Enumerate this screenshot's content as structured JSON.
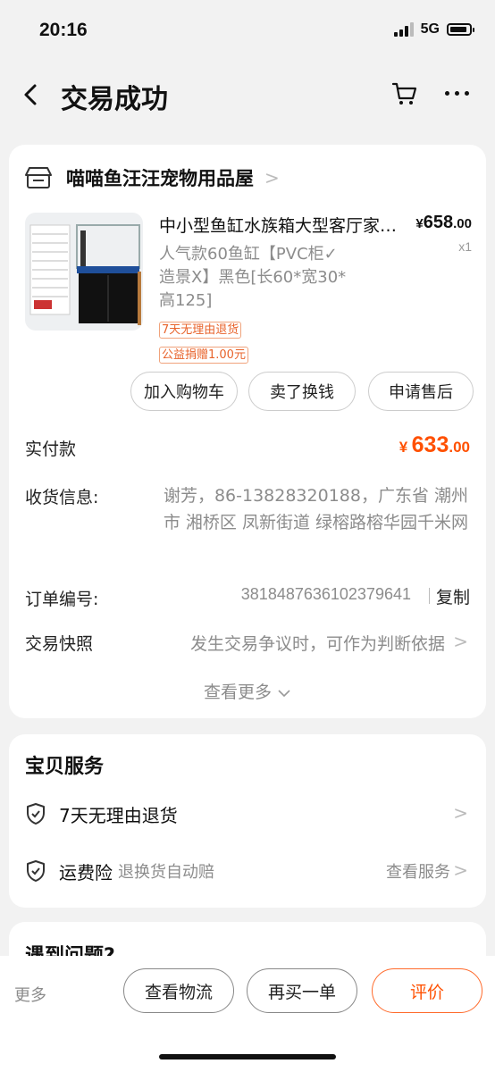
{
  "status": {
    "time": "20:16",
    "network": "5G"
  },
  "nav": {
    "title": "交易成功"
  },
  "shop": {
    "name": "喵喵鱼汪汪宠物用品屋"
  },
  "product": {
    "title": "中小型鱼缸水族箱大型客厅家用生态鱼缸",
    "price_currency": "¥",
    "price_int": "658",
    "price_dec": ".00",
    "qty": "x1",
    "sku_lines": [
      "人气款60鱼缸【PVC柜✓",
      "造景X】黑色[长60*宽30*",
      "高125]"
    ],
    "tags": [
      "7天无理由退货",
      "公益捐赠1.00元"
    ]
  },
  "actions": {
    "add_cart": "加入购物车",
    "resell": "卖了换钱",
    "after_sale": "申请售后"
  },
  "payment": {
    "label": "实付款",
    "currency": "¥",
    "int": "633",
    "dec": ".00"
  },
  "shipping": {
    "label": "收货信息:",
    "value": "谢芳，86-13828320188，广东省 潮州市 湘桥区 凤新街道 绿榕路榕华园千米网"
  },
  "order": {
    "label": "订单编号:",
    "number": "3818487636102379641",
    "copy": "复制"
  },
  "snapshot": {
    "label": "交易快照",
    "value": "发生交易争议时，可作为判断依据"
  },
  "see_more": "查看更多",
  "services": {
    "title": "宝贝服务",
    "items": [
      {
        "label": "7天无理由退货",
        "sub": ""
      },
      {
        "label": "运费险",
        "sub": "退换货自动赔",
        "action": "查看服务"
      }
    ]
  },
  "problem": {
    "title": "遇到问题?"
  },
  "bottom": {
    "more": "更多",
    "logistics": "查看物流",
    "rebuy": "再买一单",
    "review": "评价"
  },
  "colors": {
    "accent": "#ff5000",
    "tag": "#e8632b",
    "muted": "#8c8c8c"
  }
}
